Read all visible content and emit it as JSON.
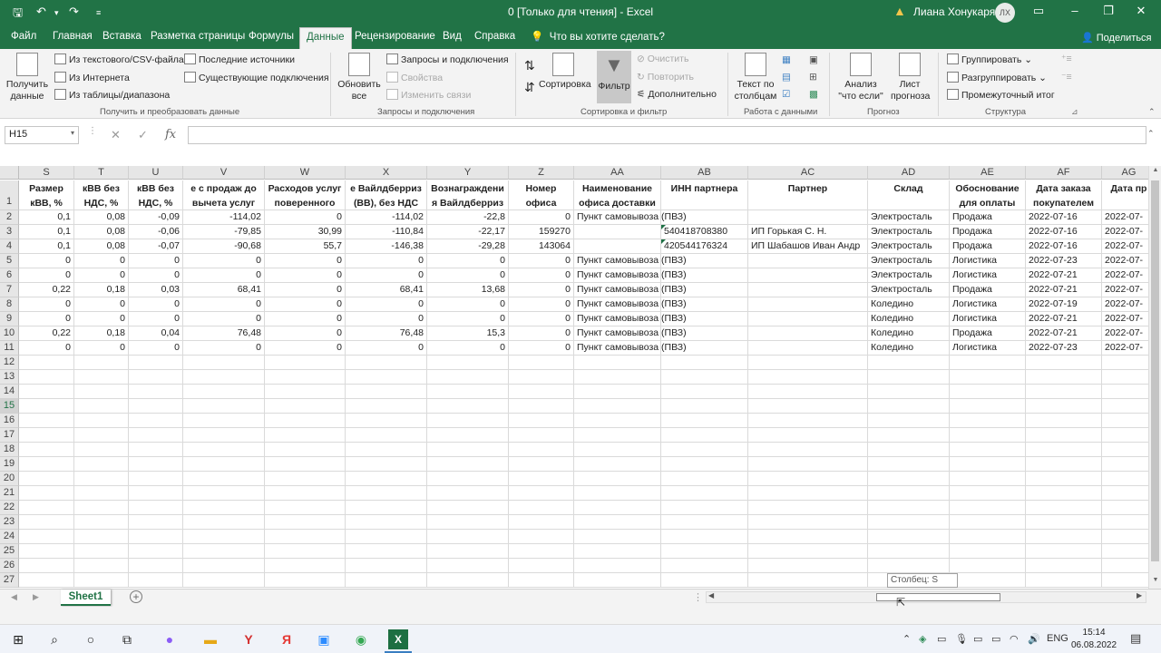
{
  "window": {
    "title": "0  [Только для чтения]  -  Excel",
    "user": "Лиана Хонукарян",
    "avatar": "ЛХ"
  },
  "ribbon_tabs": [
    "Файл",
    "Главная",
    "Вставка",
    "Разметка страницы",
    "Формулы",
    "Данные",
    "Рецензирование",
    "Вид",
    "Справка"
  ],
  "tell_me": "Что вы хотите сделать?",
  "share": "Поделиться",
  "ribbon": {
    "get_data": "Получить данные",
    "from_text": "Из текстового/CSV-файла",
    "from_web": "Из Интернета",
    "from_table": "Из таблицы/диапазона",
    "recent_sources": "Последние источники",
    "existing_connections": "Существующие подключения",
    "group_get": "Получить и преобразовать данные",
    "refresh_all": "Обновить все",
    "queries_connections": "Запросы и подключения",
    "properties": "Свойства",
    "edit_links": "Изменить связи",
    "group_queries": "Запросы и подключения",
    "sort": "Сортировка",
    "filter": "Фильтр",
    "clear": "Очистить",
    "reapply": "Повторить",
    "advanced": "Дополнительно",
    "group_sort": "Сортировка и фильтр",
    "text_to_columns": "Текст по столбцам",
    "group_tools": "Работа с данными",
    "what_if": "Анализ \"что если\"",
    "forecast_sheet": "Лист прогноза",
    "group_forecast": "Прогноз",
    "group_btn": "Группировать",
    "ungroup_btn": "Разгруппировать",
    "subtotal": "Промежуточный итог",
    "group_outline": "Структура"
  },
  "name_box": "H15",
  "fx": "fx",
  "columns": [
    {
      "letter": "S",
      "header": "Размер кВВ, %"
    },
    {
      "letter": "T",
      "header": "кВВ без НДС, %"
    },
    {
      "letter": "U",
      "header": "кВВ без НДС, %"
    },
    {
      "letter": "V",
      "header": "е с продаж до вычета услуг"
    },
    {
      "letter": "W",
      "header": "Расходов услуг поверенного"
    },
    {
      "letter": "X",
      "header": "е Вайлдберриз (ВВ), без НДС"
    },
    {
      "letter": "Y",
      "header": "Вознаграждени я Вайлдберриз"
    },
    {
      "letter": "Z",
      "header": "Номер офиса"
    },
    {
      "letter": "AA",
      "header": "Наименование офиса доставки"
    },
    {
      "letter": "AB",
      "header": "ИНН партнера"
    },
    {
      "letter": "AC",
      "header": "Партнер"
    },
    {
      "letter": "AD",
      "header": "Склад"
    },
    {
      "letter": "AE",
      "header": "Обоснование для оплаты"
    },
    {
      "letter": "AF",
      "header": "Дата заказа покупателем"
    },
    {
      "letter": "AG",
      "header": "Дата пр"
    }
  ],
  "rows": [
    [
      "0,1",
      "0,08",
      "-0,09",
      "-114,02",
      "0",
      "-114,02",
      "-22,8",
      "0",
      "Пункт самовывоза (ПВЗ)",
      "",
      "",
      "Электросталь",
      "Продажа",
      "2022-07-16",
      "2022-07-"
    ],
    [
      "0,1",
      "0,08",
      "-0,06",
      "-79,85",
      "30,99",
      "-110,84",
      "-22,17",
      "159270",
      "",
      "540418708380",
      "ИП Горькая С. Н.",
      "Электросталь",
      "Продажа",
      "2022-07-16",
      "2022-07-"
    ],
    [
      "0,1",
      "0,08",
      "-0,07",
      "-90,68",
      "55,7",
      "-146,38",
      "-29,28",
      "143064",
      "",
      "420544176324",
      "ИП Шабашов Иван Андр",
      "Электросталь",
      "Продажа",
      "2022-07-16",
      "2022-07-"
    ],
    [
      "0",
      "0",
      "0",
      "0",
      "0",
      "0",
      "0",
      "0",
      "Пункт самовывоза (ПВЗ)",
      "",
      "",
      "Электросталь",
      "Логистика",
      "2022-07-23",
      "2022-07-"
    ],
    [
      "0",
      "0",
      "0",
      "0",
      "0",
      "0",
      "0",
      "0",
      "Пункт самовывоза (ПВЗ)",
      "",
      "",
      "Электросталь",
      "Логистика",
      "2022-07-21",
      "2022-07-"
    ],
    [
      "0,22",
      "0,18",
      "0,03",
      "68,41",
      "0",
      "68,41",
      "13,68",
      "0",
      "Пункт самовывоза (ПВЗ)",
      "",
      "",
      "Электросталь",
      "Продажа",
      "2022-07-21",
      "2022-07-"
    ],
    [
      "0",
      "0",
      "0",
      "0",
      "0",
      "0",
      "0",
      "0",
      "Пункт самовывоза (ПВЗ)",
      "",
      "",
      "Коледино",
      "Логистика",
      "2022-07-19",
      "2022-07-"
    ],
    [
      "0",
      "0",
      "0",
      "0",
      "0",
      "0",
      "0",
      "0",
      "Пункт самовывоза (ПВЗ)",
      "",
      "",
      "Коледино",
      "Логистика",
      "2022-07-21",
      "2022-07-"
    ],
    [
      "0,22",
      "0,18",
      "0,04",
      "76,48",
      "0",
      "76,48",
      "15,3",
      "0",
      "Пункт самовывоза (ПВЗ)",
      "",
      "",
      "Коледино",
      "Продажа",
      "2022-07-21",
      "2022-07-"
    ],
    [
      "0",
      "0",
      "0",
      "0",
      "0",
      "0",
      "0",
      "0",
      "Пункт самовывоза (ПВЗ)",
      "",
      "",
      "Коледино",
      "Логистика",
      "2022-07-23",
      "2022-07-"
    ]
  ],
  "row_numbers": [
    "1",
    "2",
    "3",
    "4",
    "5",
    "6",
    "7",
    "8",
    "9",
    "10",
    "11",
    "12",
    "13",
    "14",
    "15",
    "16",
    "17",
    "18",
    "19",
    "20",
    "21",
    "22",
    "23",
    "24",
    "25",
    "26",
    "27"
  ],
  "selected_row": "15",
  "sheet_tab": "Sheet1",
  "tooltip": "Столбец: S",
  "taskbar": {
    "lang": "ENG",
    "time": "15:14",
    "date": "06.08.2022"
  }
}
